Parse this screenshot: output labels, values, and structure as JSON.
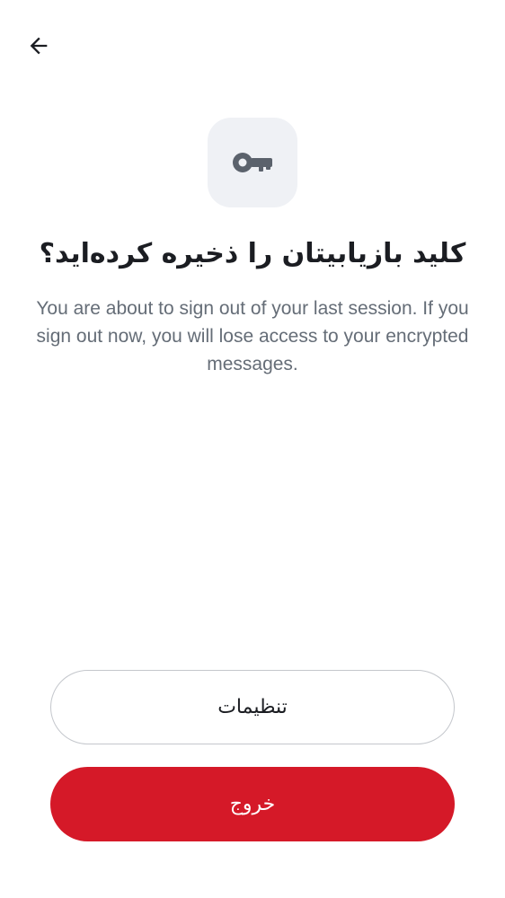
{
  "header": {
    "back_icon": "arrow-left-icon"
  },
  "hero": {
    "icon": "key-icon",
    "tile_color": "#eff1f5"
  },
  "title": "کلید بازیابیتان را ذخیره کرده‌اید؟",
  "description": "You are about to sign out of your last session. If you sign out now, you will lose access to your encrypted messages.",
  "actions": {
    "settings_label": "تنظیمات",
    "signout_label": "خروج",
    "signout_color": "#d51928"
  }
}
